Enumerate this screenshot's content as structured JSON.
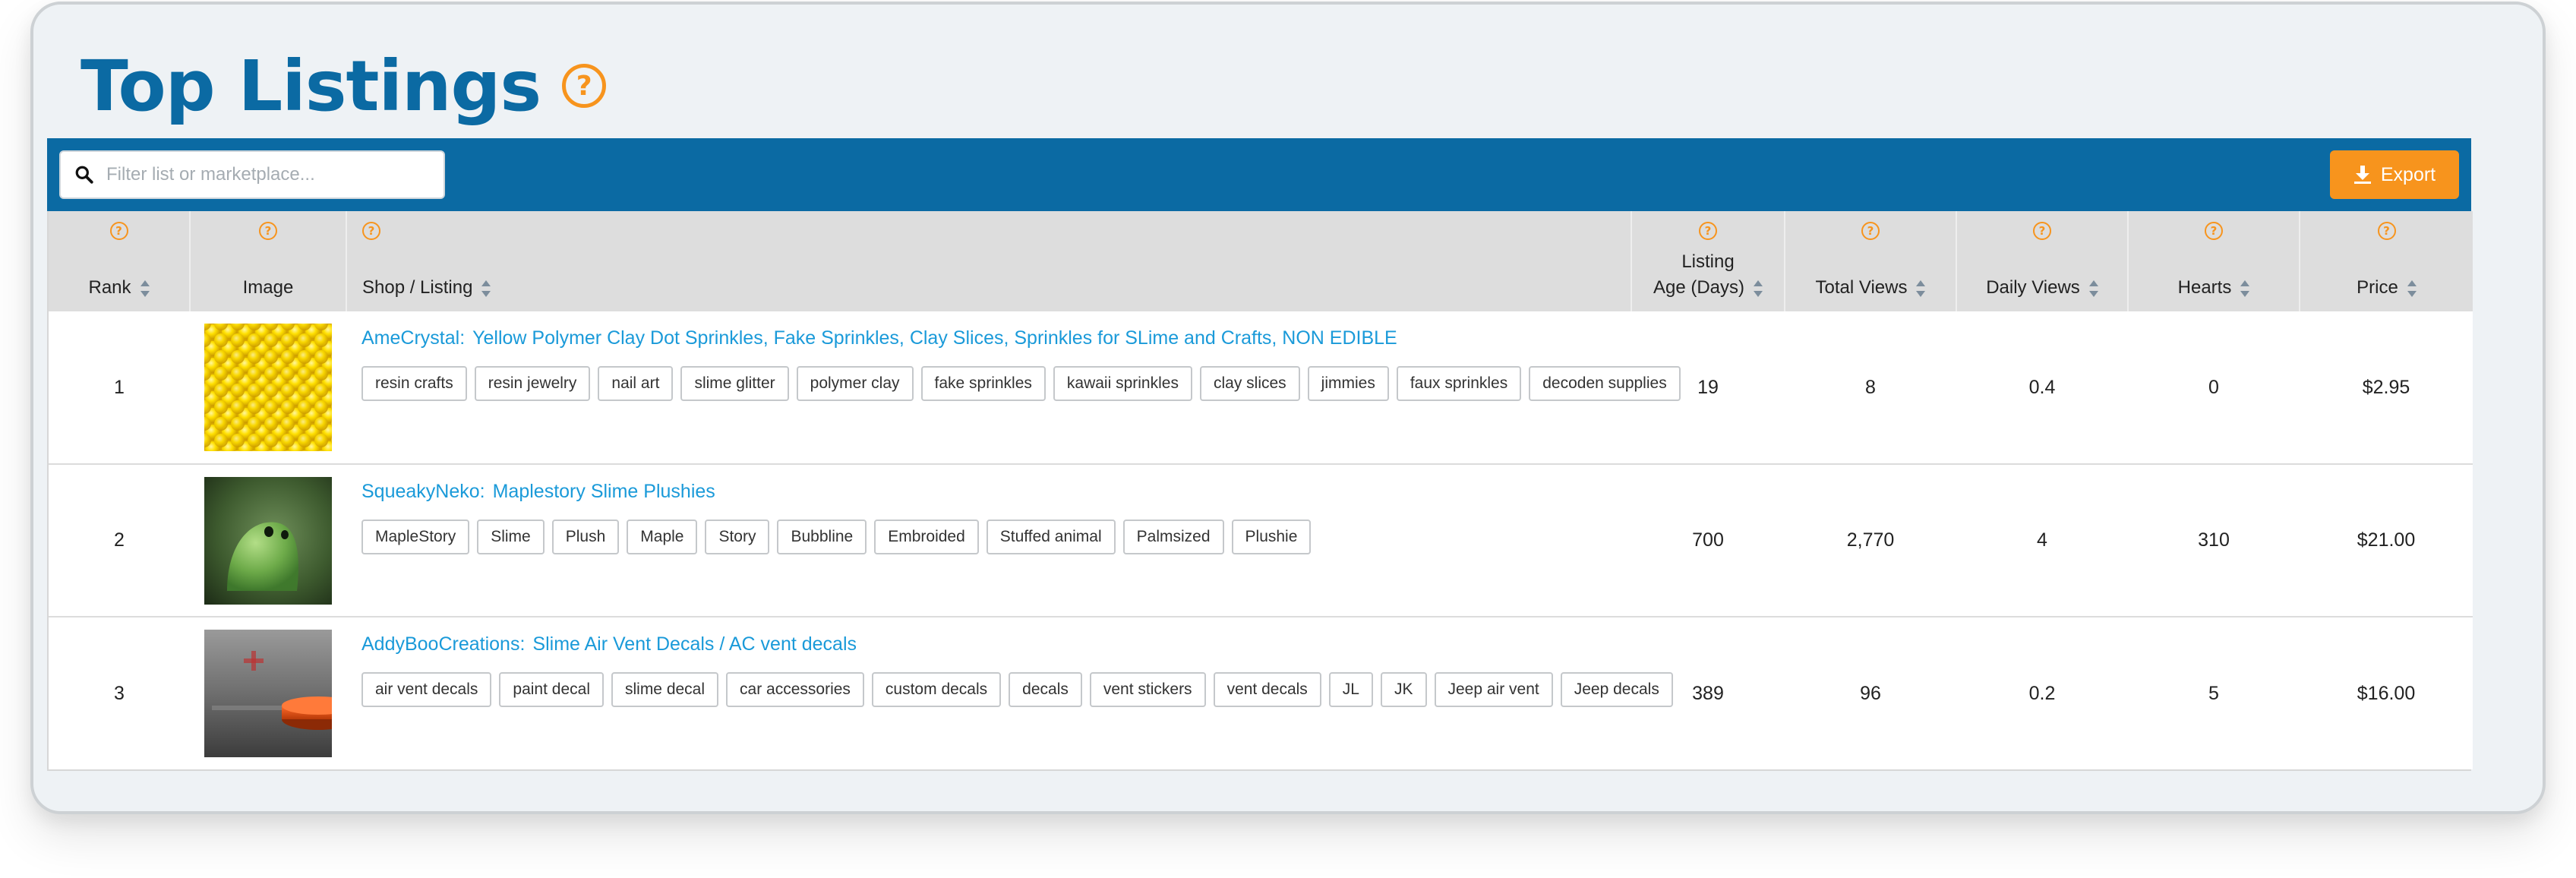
{
  "page": {
    "title": "Top Listings",
    "help_glyph": "?"
  },
  "toolbar": {
    "search_placeholder": "Filter list or marketplace...",
    "search_icon": "search-icon",
    "export_label": "Export",
    "export_icon": "download-icon"
  },
  "colors": {
    "brand_blue": "#0b6aa3",
    "accent_orange": "#f7941d",
    "link_blue": "#1a9ad9"
  },
  "columns": [
    {
      "key": "rank",
      "label": "Rank"
    },
    {
      "key": "image",
      "label": "Image"
    },
    {
      "key": "listing",
      "label": "Shop / Listing"
    },
    {
      "key": "age",
      "label_line1": "Listing",
      "label_line2": "Age (Days)"
    },
    {
      "key": "total_views",
      "label": "Total Views"
    },
    {
      "key": "daily_views",
      "label": "Daily Views"
    },
    {
      "key": "hearts",
      "label": "Hearts"
    },
    {
      "key": "price",
      "label": "Price"
    }
  ],
  "rows": [
    {
      "rank": "1",
      "image": "yellow-clay-sprinkles-photo",
      "shop": "AmeCrystal",
      "title": "Yellow Polymer Clay Dot Sprinkles, Fake Sprinkles, Clay Slices, Sprinkles for SLime and Crafts, NON EDIBLE",
      "tags": [
        "resin crafts",
        "resin jewelry",
        "nail art",
        "slime glitter",
        "polymer clay",
        "fake sprinkles",
        "kawaii sprinkles",
        "clay slices",
        "jimmies",
        "faux sprinkles",
        "decoden supplies"
      ],
      "age": "19",
      "total_views": "8",
      "daily_views": "0.4",
      "hearts": "0",
      "price": "$2.95"
    },
    {
      "rank": "2",
      "image": "green-slime-plush-photo",
      "shop": "SqueakyNeko",
      "title": "Maplestory Slime Plushies",
      "tags": [
        "MapleStory",
        "Slime",
        "Plush",
        "Maple",
        "Story",
        "Bubbline",
        "Embroided",
        "Stuffed animal",
        "Palmsized",
        "Plushie"
      ],
      "age": "700",
      "total_views": "2,770",
      "daily_views": "4",
      "hearts": "310",
      "price": "$21.00"
    },
    {
      "rank": "3",
      "image": "air-vent-decal-photo",
      "shop": "AddyBooCreations",
      "title": "Slime Air Vent Decals / AC vent decals",
      "tags": [
        "air vent decals",
        "paint decal",
        "slime decal",
        "car accessories",
        "custom decals",
        "decals",
        "vent stickers",
        "vent decals",
        "JL",
        "JK",
        "Jeep air vent",
        "Jeep decals"
      ],
      "age": "389",
      "total_views": "96",
      "daily_views": "0.2",
      "hearts": "5",
      "price": "$16.00"
    }
  ]
}
